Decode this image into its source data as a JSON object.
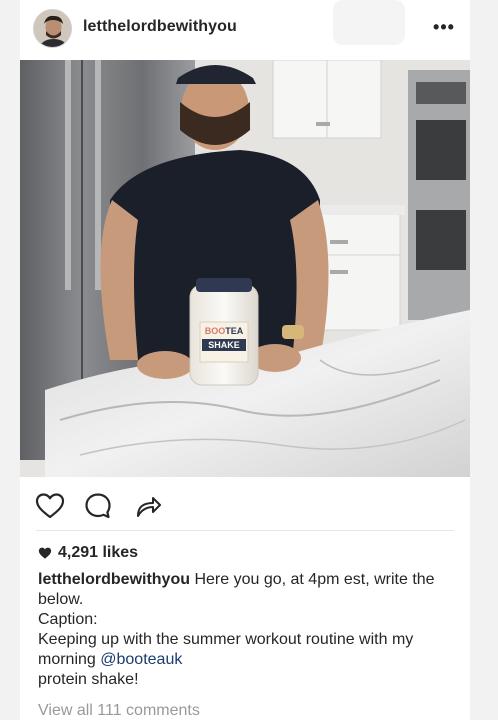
{
  "post": {
    "username": "letthelordbewithyou",
    "likes": "4,291 likes",
    "caption": {
      "username": "letthelordbewithyou",
      "line1": "Here you go, at 4pm est, write the below.",
      "line2": "Caption:",
      "line3": "Keeping up with the summer workout routine with my morning",
      "mention": "@booteauk",
      "line4": "protein shake!"
    },
    "view_comments": "View all 111 comments",
    "product_label": {
      "brand_top": "BOO",
      "brand_bottom": "TEA",
      "product": "SHAKE"
    }
  },
  "icons": {
    "more": "more-options-icon",
    "like": "heart-outline-icon",
    "comment": "comment-bubble-icon",
    "share": "share-arrow-icon",
    "likes_heart": "heart-filled-icon"
  },
  "colors": {
    "text": "#262626",
    "muted": "#999999",
    "mention": "#1a3c6e",
    "background": "#ffffff"
  }
}
